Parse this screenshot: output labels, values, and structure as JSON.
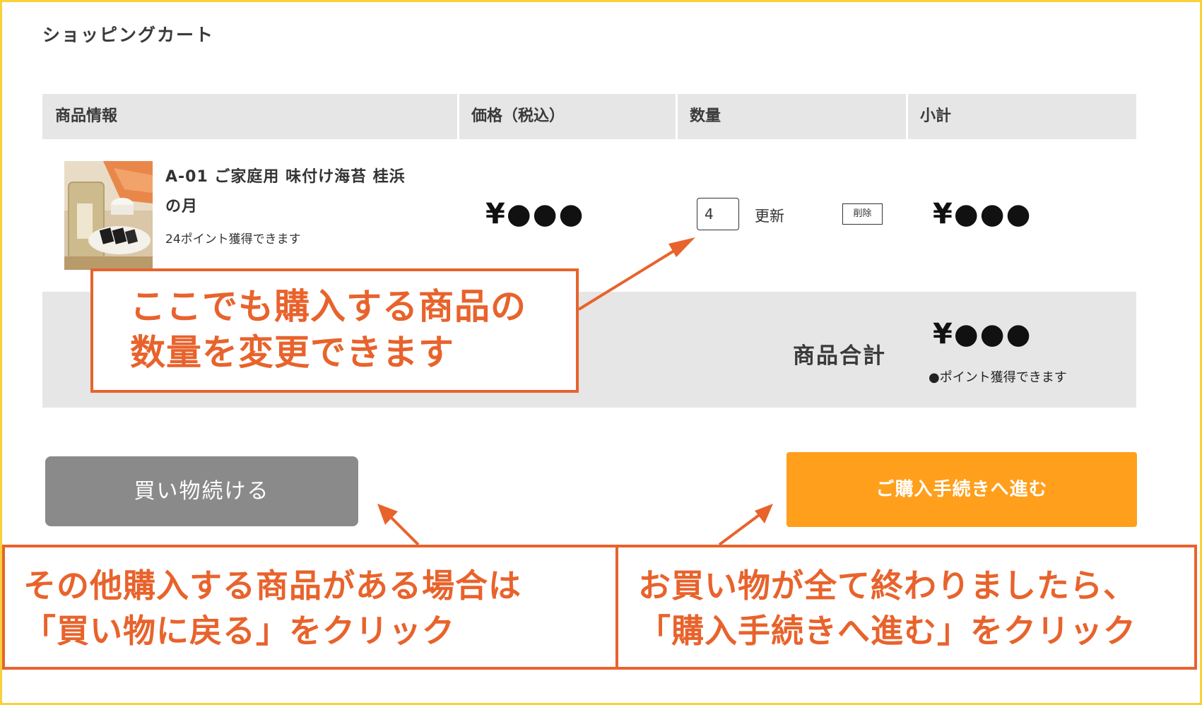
{
  "page": {
    "title": "ショッピングカート"
  },
  "table": {
    "headers": [
      "商品情報",
      "価格（税込）",
      "数量",
      "小計"
    ],
    "item": {
      "name_line1": "A-01 ご家庭用 味付け海苔 桂浜",
      "name_line2": "の月",
      "points": "24ポイント獲得できます",
      "price": "¥●●●",
      "quantity": "4",
      "update_label": "更新",
      "delete_label": "削除",
      "subtotal": "¥●●●"
    }
  },
  "summary": {
    "label": "商品合計",
    "total": "¥●●●",
    "points": "●ポイント獲得できます"
  },
  "buttons": {
    "continue_label": "買い物続ける",
    "checkout_label": "ご購入手続きへ進む"
  },
  "callouts": {
    "quantity": [
      "ここでも購入する商品の",
      "数量を変更できます"
    ],
    "continue": [
      "その他購入する商品がある場合は",
      "「買い物に戻る」をクリック"
    ],
    "checkout": [
      "お買い物が全て終わりましたら、",
      "「購入手続きへ進む」をクリック"
    ]
  },
  "colors": {
    "frame": "#f7d23a",
    "callout": "#e8632c",
    "checkout_button": "#ff9f1c",
    "continue_button": "#8a8a8a",
    "table_header_bg": "#e6e6e6"
  }
}
